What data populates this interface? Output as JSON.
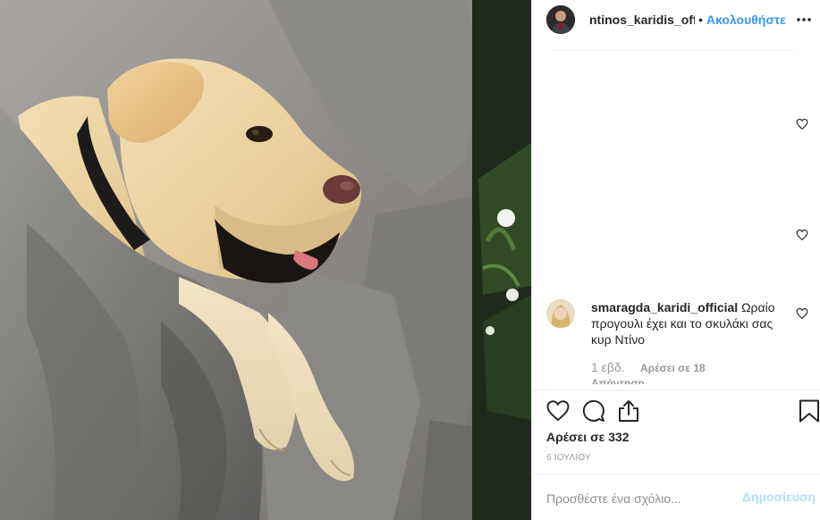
{
  "post": {
    "owner": {
      "username": "ntinos_karidis_official",
      "follow_label": "Ακολουθήστε",
      "separator": "•"
    },
    "more_icon": "more-horizontal-icon",
    "image_description_icon": "photo"
  },
  "comments": [
    {
      "username": "smaragda_karidi_official",
      "text": "Ωραίο προγουλι έχει και το σκυλάκι σας κυρ Ντίνο",
      "age": "1 εβδ.",
      "likes": "Αρέσει σε 18",
      "reply_label": "Απάντηση"
    }
  ],
  "actions": {
    "like_icon": "heart-icon",
    "comment_icon": "comment-icon",
    "share_icon": "share-icon",
    "save_icon": "bookmark-icon",
    "likes_total": "Αρέσει σε 332",
    "date": "6 ΙΟΥΛΙΟΥ"
  },
  "composer": {
    "placeholder": "Προσθέστε ένα σχόλιο...",
    "publish_label": "Δημοσίευση"
  },
  "colors": {
    "link_blue": "#3897f0",
    "publish_disabled": "#b2dffc",
    "text_dark": "#262626",
    "text_muted": "#999999",
    "separator": "#efefef"
  }
}
